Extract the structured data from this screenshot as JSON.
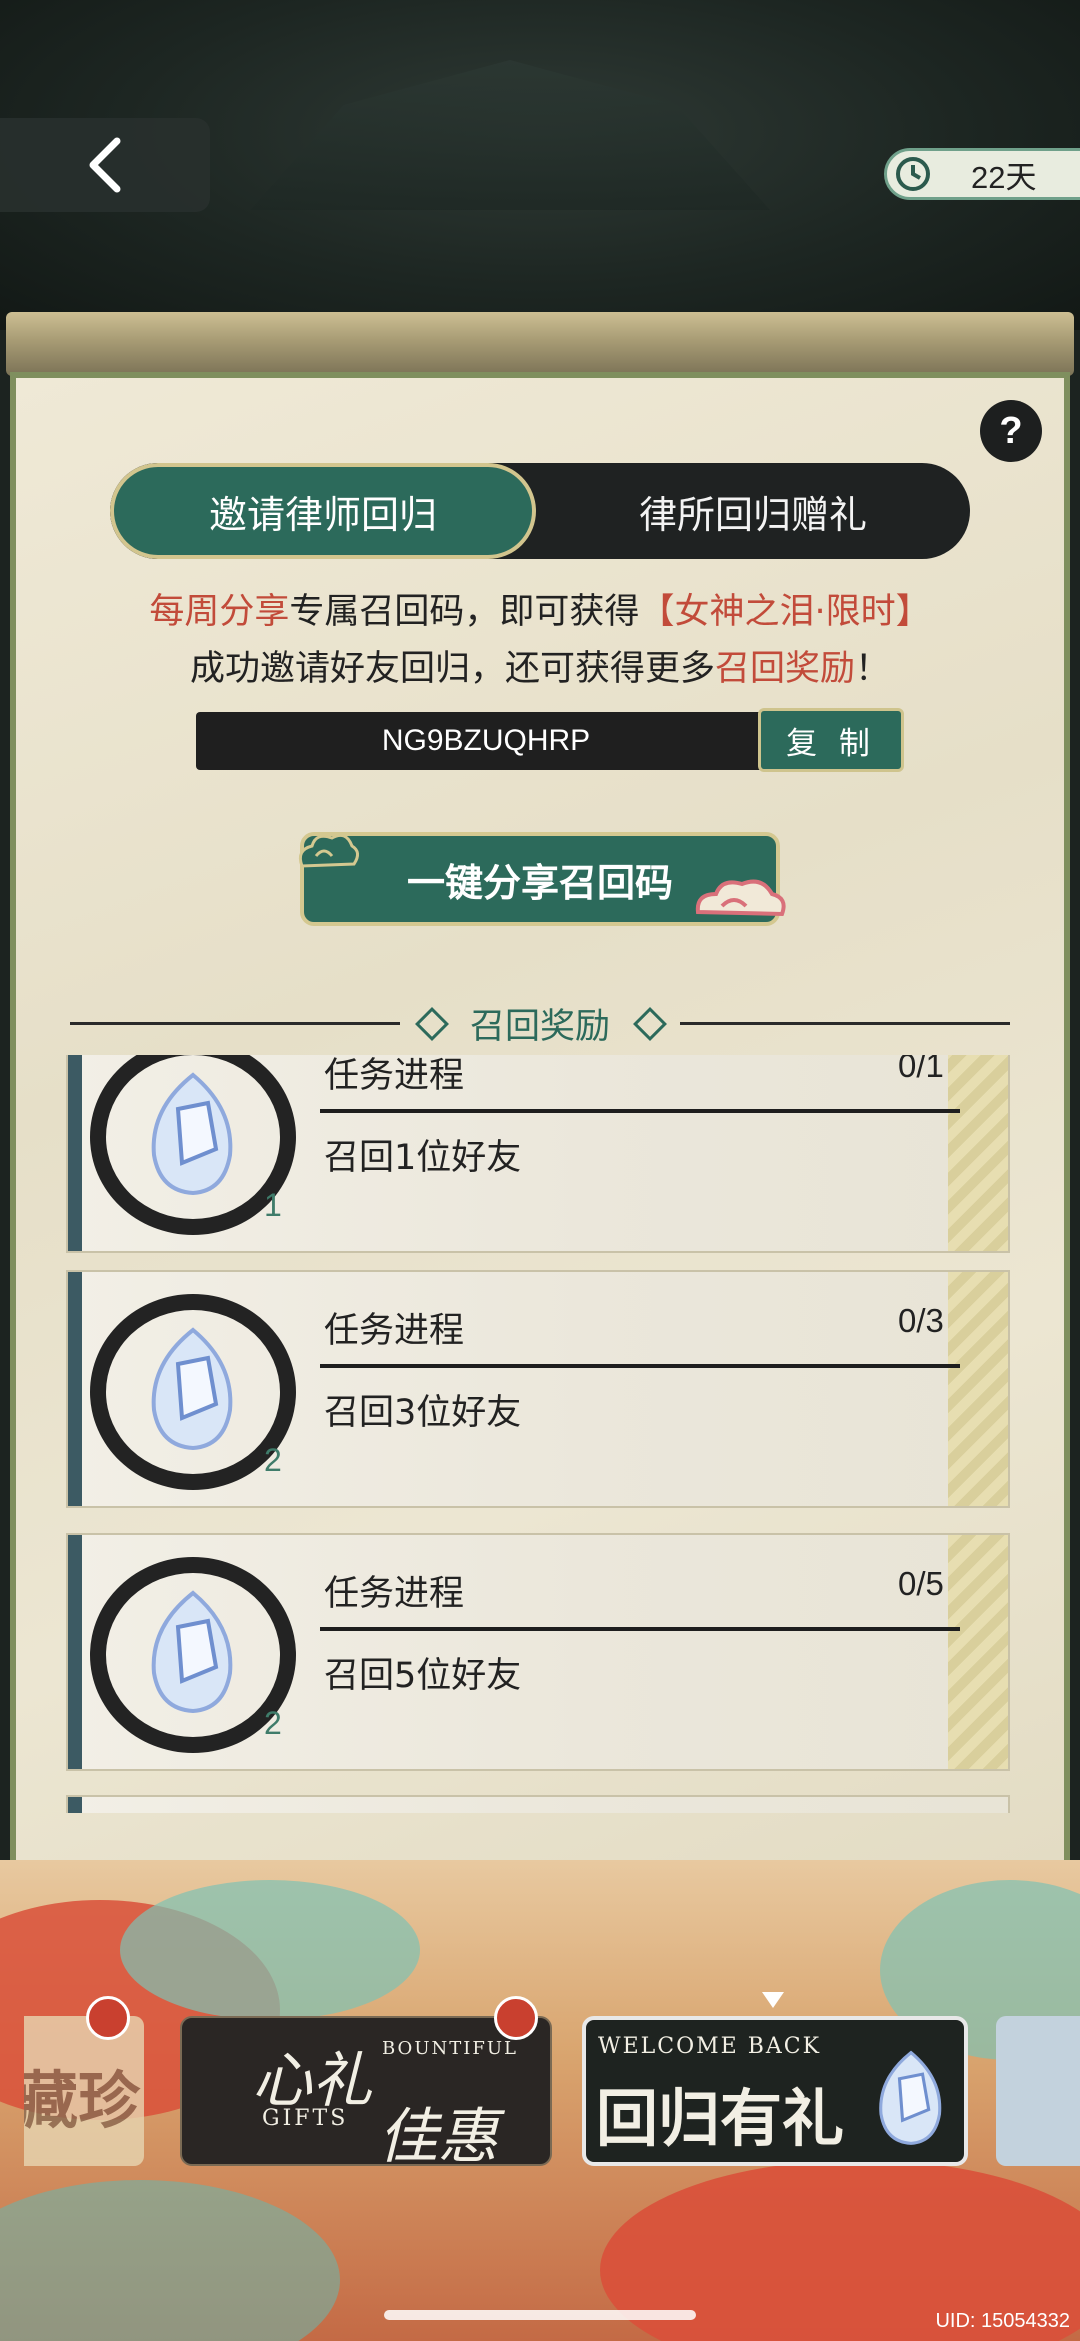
{
  "header": {
    "back_label": "<",
    "timer_text": "22天"
  },
  "tabs": [
    {
      "label": "邀请律师回归",
      "active": true
    },
    {
      "label": "律所回归赠礼",
      "active": false
    }
  ],
  "description": {
    "line1_part1": "每周分享",
    "line1_part2": "专属召回码，即可获得",
    "line1_part3": "【女神之泪·限时】",
    "line2_part1": "成功邀请好友回归，还可获得更多",
    "line2_part2": "召回奖励",
    "line2_part3": "！"
  },
  "code": {
    "value": "NG9BZUQHRP",
    "copy_label": "复 制"
  },
  "share_button": "一键分享召回码",
  "section_title": "召回奖励",
  "tasks": [
    {
      "label": "任务进程",
      "progress": "0/1",
      "desc": "召回1位好友",
      "count": "1"
    },
    {
      "label": "任务进程",
      "progress": "0/3",
      "desc": "召回3位好友",
      "count": "2"
    },
    {
      "label": "任务进程",
      "progress": "0/5",
      "desc": "召回5位好友",
      "count": "2"
    }
  ],
  "banners": {
    "b1_text": "藏珍",
    "b2_big1": "心礼",
    "b2_big2": "佳惠",
    "b2_en1": "BOUNTIFUL",
    "b2_en2": "GIFTS",
    "b3_en": "WELCOME BACK",
    "b3_big": "回归有礼"
  },
  "uid": "UID: 15054332",
  "colors": {
    "accent_green": "#2c6a5b",
    "highlight_red": "#c24b3a",
    "panel_bg": "#ece6d2"
  },
  "icons": [
    "chevron-left-icon",
    "clock-icon",
    "help-icon",
    "gem-icon",
    "cloud-icon",
    "alarm-icon"
  ]
}
